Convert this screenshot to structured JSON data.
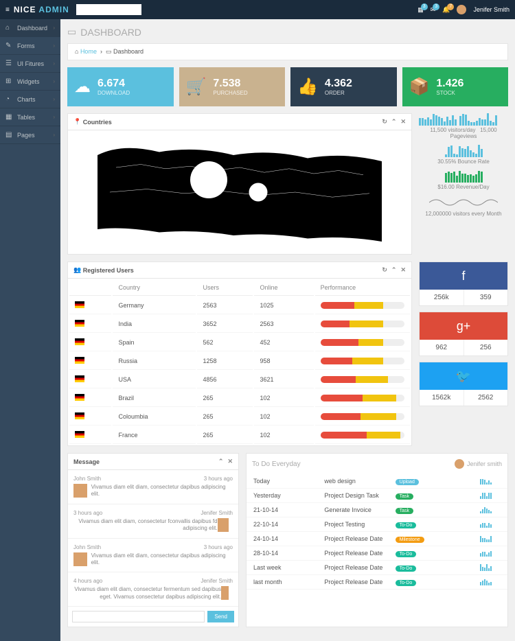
{
  "brand": {
    "a": "NICE",
    "b": "ADMIN"
  },
  "header": {
    "notif1": "3",
    "notif2": "3",
    "notif3": "7",
    "user": "Jenifer Smith"
  },
  "sidebar": [
    {
      "icon": "⌂",
      "label": "Dashboard"
    },
    {
      "icon": "✎",
      "label": "Forms"
    },
    {
      "icon": "☰",
      "label": "UI Fitures"
    },
    {
      "icon": "⊞",
      "label": "Widgets"
    },
    {
      "icon": "◔",
      "label": "Charts"
    },
    {
      "icon": "▦",
      "label": "Tables"
    },
    {
      "icon": "▤",
      "label": "Pages"
    }
  ],
  "page": {
    "title": "DASHBOARD",
    "bc_home": "Home",
    "bc_cur": "Dashboard"
  },
  "cards": [
    {
      "num": "6.674",
      "lbl": "DOWNLOAD"
    },
    {
      "num": "7.538",
      "lbl": "PURCHASED"
    },
    {
      "num": "4.362",
      "lbl": "ORDER"
    },
    {
      "num": "1.426",
      "lbl": "STOCK"
    }
  ],
  "map_title": "Countries",
  "stats": [
    {
      "txt": "11,500 visitors/day"
    },
    {
      "txt": "15,000 Pageviews"
    },
    {
      "txt": "30.55% Bounce Rate"
    },
    {
      "txt": "$16.00 Revenue/Day"
    },
    {
      "txt": "12,000000 visitors every Month"
    }
  ],
  "users_title": "Registered Users",
  "users_cols": [
    "",
    "Country",
    "Users",
    "Online",
    "Performance"
  ],
  "users": [
    {
      "c": "Germany",
      "u": "2563",
      "o": "1025",
      "p1": 40,
      "p2": 35
    },
    {
      "c": "India",
      "u": "3652",
      "o": "2563",
      "p1": 35,
      "p2": 40
    },
    {
      "c": "Spain",
      "u": "562",
      "o": "452",
      "p1": 45,
      "p2": 30
    },
    {
      "c": "Russia",
      "u": "1258",
      "o": "958",
      "p1": 38,
      "p2": 37
    },
    {
      "c": "USA",
      "u": "4856",
      "o": "3621",
      "p1": 42,
      "p2": 38
    },
    {
      "c": "Brazil",
      "u": "265",
      "o": "102",
      "p1": 50,
      "p2": 40
    },
    {
      "c": "Coloumbia",
      "u": "265",
      "o": "102",
      "p1": 48,
      "p2": 42
    },
    {
      "c": "France",
      "u": "265",
      "o": "102",
      "p1": 55,
      "p2": 40
    }
  ],
  "social": [
    {
      "a": "256k",
      "b": "359"
    },
    {
      "a": "962",
      "b": "256"
    },
    {
      "a": "1562k",
      "b": "2562"
    }
  ],
  "msg_title": "Message",
  "msgs": [
    {
      "n": "John Smith",
      "t": "3 hours ago",
      "txt": "Vivamus diam elit diam, consectetur dapibus adipiscing elit."
    },
    {
      "n": "Jenifer Smith",
      "t": "3 hours ago",
      "txt": "Vivamus diam elit diam, consectetur fconvallis dapibus fd adipiscing elit."
    },
    {
      "n": "John Smith",
      "t": "3 hours ago",
      "txt": "Vivamus diam elit diam, consectetur dapibus adipiscing elit."
    },
    {
      "n": "Jenifer Smith",
      "t": "4 hours ago",
      "txt": "Vivamus diam elit diam, consectetur fermentum sed dapibus eget. Vivamus consectetur dapibus adipiscing elit."
    }
  ],
  "msg_send": "Send",
  "todo_title": "To Do Everyday",
  "todo_user": "Jenifer smith",
  "todos": [
    {
      "d": "Today",
      "t": "web design",
      "tag": "Upload",
      "tc": "t-blue"
    },
    {
      "d": "Yesterday",
      "t": "Project Design Task",
      "tag": "Task",
      "tc": "t-green"
    },
    {
      "d": "21-10-14",
      "t": "Generate Invoice",
      "tag": "Task",
      "tc": "t-green"
    },
    {
      "d": "22-10-14",
      "t": "Project Testing",
      "tag": "To-Do",
      "tc": "t-teal"
    },
    {
      "d": "24-10-14",
      "t": "Project Release Date",
      "tag": "Milestone",
      "tc": "t-orange"
    },
    {
      "d": "28-10-14",
      "t": "Project Release Date",
      "tag": "To-Do",
      "tc": "t-teal"
    },
    {
      "d": "Last week",
      "t": "Project Release Date",
      "tag": "To-Do",
      "tc": "t-teal"
    },
    {
      "d": "last month",
      "t": "Project Release Date",
      "tag": "To-Do",
      "tc": "t-teal"
    }
  ]
}
